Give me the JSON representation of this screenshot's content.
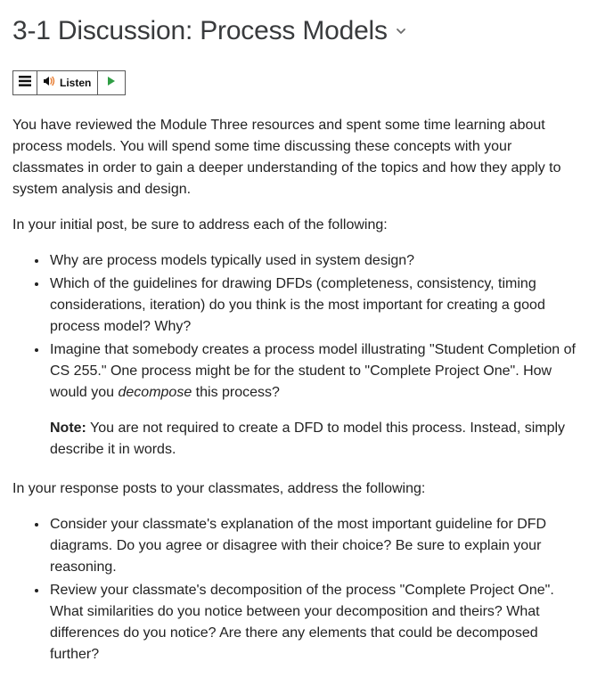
{
  "header": {
    "title": "3-1 Discussion: Process Models"
  },
  "toolbar": {
    "listen_label": "Listen"
  },
  "body": {
    "intro": "You have reviewed the Module Three resources and spent some time learning about process models. You will spend some time discussing these concepts with your classmates in order to gain a deeper understanding of the topics and how they apply to system analysis and design.",
    "initial_post_prompt": "In your initial post, be sure to address each of the following:",
    "initial_bullets": {
      "b1": "Why are process models typically used in system design?",
      "b2": "Which of the guidelines for drawing DFDs (completeness, consistency, timing considerations, iteration) do you think is the most important for creating a good process model? Why?",
      "b3_part1": "Imagine that somebody creates a process model illustrating \"Student Completion of CS 255.\" One process might be for the student to \"Complete Project One\". How would you ",
      "b3_emph": "decompose",
      "b3_part2": " this process?",
      "note_label": "Note:",
      "note_text": " You are not required to create a DFD to model this process. Instead, simply describe it in words."
    },
    "response_prompt": "In your response posts to your classmates, address the following:",
    "response_bullets": {
      "r1": "Consider your classmate's explanation of the most important guideline for DFD diagrams. Do you agree or disagree with their choice? Be sure to explain your reasoning.",
      "r2": "Review your classmate's decomposition of the process \"Complete Project One\". What similarities do you notice between your decomposition and theirs? What differences do you notice? Are there any elements that could be decomposed further?"
    }
  }
}
